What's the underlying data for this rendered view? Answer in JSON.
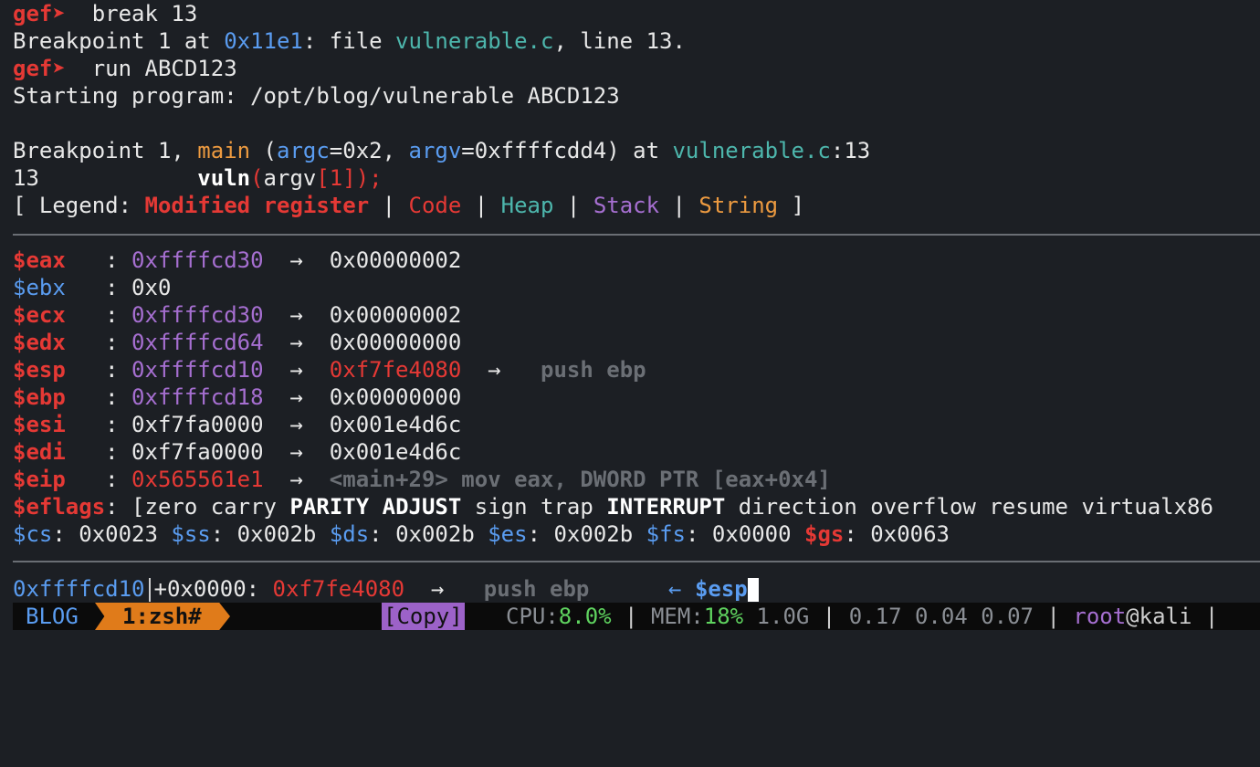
{
  "prompt": "gef➤",
  "line1": {
    "cmd": "  break 13"
  },
  "line2": {
    "a": "Breakpoint 1 at ",
    "addr": "0x11e1",
    "b": ": file ",
    "file": "vulnerable.c",
    "c": ", line 13."
  },
  "line3": {
    "cmd": "  run ABCD123"
  },
  "line4": {
    "text": "Starting program: /opt/blog/vulnerable ABCD123"
  },
  "line5": {
    "a": "Breakpoint 1, ",
    "func": "main",
    "b": " (",
    "arg1": "argc",
    "c": "=0x2, ",
    "arg2": "argv",
    "d": "=0xffffcdd4) at ",
    "file": "vulnerable.c",
    "e": ":13"
  },
  "line6": {
    "num": "13",
    "indent": "            ",
    "fn": "vuln",
    "p1": "(",
    "arg": "argv",
    "idx": "[1]",
    "p2": ");"
  },
  "legend": {
    "open": "[ Legend: ",
    "modified": "Modified register",
    "sep": " | ",
    "code": "Code",
    "heap": "Heap",
    "stack": "Stack",
    "string": "String",
    "close": " ]"
  },
  "registers": {
    "eax": {
      "name": "$eax",
      "pad": "   : ",
      "val": "0xffffcd30",
      "arrow": "  →  ",
      "deref": "0x00000002"
    },
    "ebx": {
      "name": "$ebx",
      "pad": "   : ",
      "val": "0x0"
    },
    "ecx": {
      "name": "$ecx",
      "pad": "   : ",
      "val": "0xffffcd30",
      "arrow": "  →  ",
      "deref": "0x00000002"
    },
    "edx": {
      "name": "$edx",
      "pad": "   : ",
      "val": "0xffffcd64",
      "arrow": "  →  ",
      "deref": "0x00000000"
    },
    "esp": {
      "name": "$esp",
      "pad": "   : ",
      "val": "0xffffcd10",
      "arrow": "  →  ",
      "deref": "0xf7fe4080",
      "arrow2": "  →   ",
      "instr": "push ebp"
    },
    "ebp": {
      "name": "$ebp",
      "pad": "   : ",
      "val": "0xffffcd18",
      "arrow": "  →  ",
      "deref": "0x00000000"
    },
    "esi": {
      "name": "$esi",
      "pad": "   : ",
      "val": "0xf7fa0000",
      "arrow": "  →  ",
      "deref": "0x001e4d6c"
    },
    "edi": {
      "name": "$edi",
      "pad": "   : ",
      "val": "0xf7fa0000",
      "arrow": "  →  ",
      "deref": "0x001e4d6c"
    },
    "eip": {
      "name": "$eip",
      "pad": "   : ",
      "val": "0x565561e1",
      "arrow": "  →  ",
      "instr": "<main+29> mov eax, DWORD PTR [eax+0x4]"
    }
  },
  "eflags": {
    "name": "$eflags",
    "colon": ": [",
    "zero": "zero carry ",
    "parity": "PARITY ADJUST",
    "sign": " sign trap ",
    "interrupt": "INTERRUPT",
    "rest": " direction overflow resume virtualx86"
  },
  "segments": {
    "cs": "$cs",
    "cs_val": ": 0x0023 ",
    "ss": "$ss",
    "ss_val": ": 0x002b ",
    "ds": "$ds",
    "ds_val": ": 0x002b ",
    "es": "$es",
    "es_val": ": 0x002b ",
    "fs": "$fs",
    "fs_val": ": 0x0000 ",
    "gs": "$gs",
    "gs_val": ": 0x0063"
  },
  "stack_line": {
    "addr": "0xffffcd10",
    "offset": "+0x0000: ",
    "val": "0xf7fe4080",
    "arrow": "  →   ",
    "instr": "push ebp",
    "tag_arrow": "      ← ",
    "tag": "$esp"
  },
  "statusbar": {
    "session": "BLOG",
    "window": "1:zsh#",
    "copy": "[Copy]",
    "cpu_label": "CPU:",
    "cpu_val": "8.0%",
    "sep1": " | ",
    "mem_label": "MEM:",
    "mem_val": "18%",
    "mem_size": " 1.0G",
    "sep2": " | ",
    "load": "0.17 0.04 0.07",
    "sep3": " | ",
    "user": "root",
    "host": "@kali",
    "sep4": " |"
  },
  "colors": {
    "background": "#1c1f24",
    "red": "#e53935",
    "blue": "#5a9cf0",
    "cyan": "#4db6ac",
    "orange": "#ec9a40",
    "purple": "#a66fd1",
    "grey": "#6b6f75",
    "status_bg": "#0b0b0b",
    "tab_bg": "#e07b1a",
    "copy_bg": "#9c62c8",
    "green": "#5fd35f"
  }
}
